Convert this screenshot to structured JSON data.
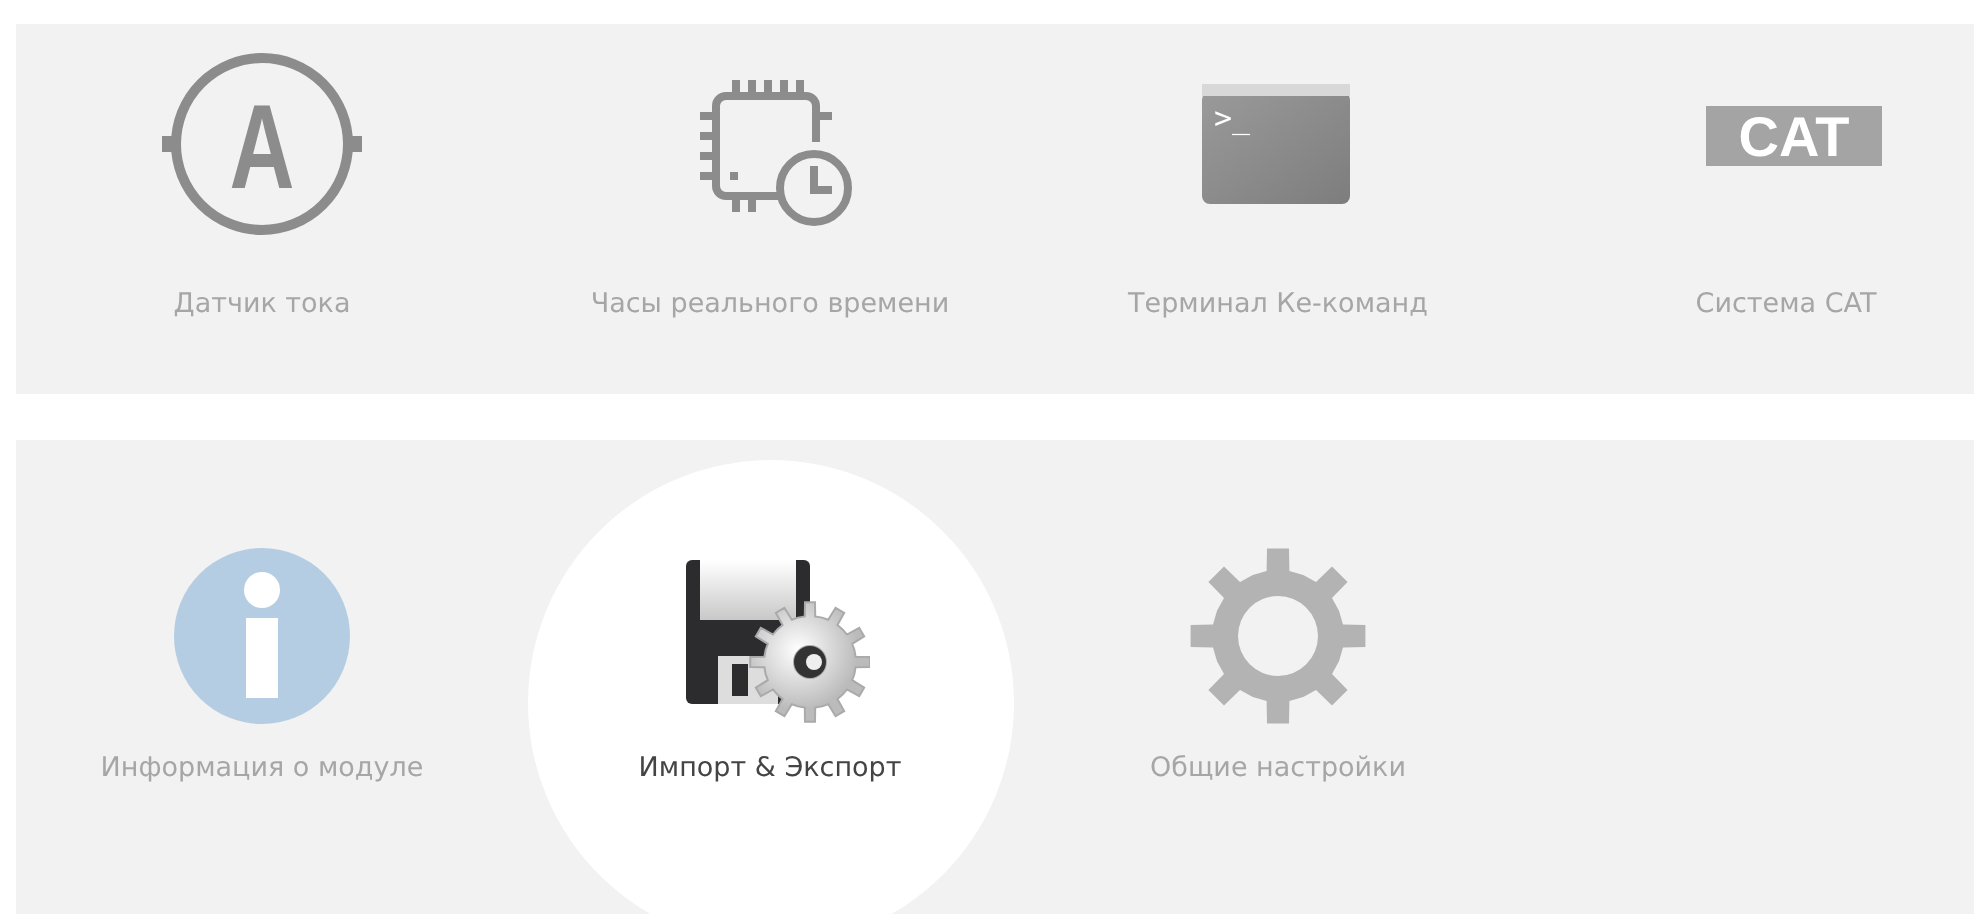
{
  "rows": [
    {
      "items": [
        {
          "kind": "ammeter",
          "icon_text": "A",
          "label": "Датчик тока",
          "selected": false
        },
        {
          "kind": "clock-chip",
          "label": "Часы реального времени",
          "selected": false
        },
        {
          "kind": "terminal",
          "icon_text": ">_",
          "label": "Терминал Ке-команд",
          "selected": false
        },
        {
          "kind": "cat",
          "icon_text": "CAT",
          "label": "Система CAT",
          "selected": false
        }
      ]
    },
    {
      "items": [
        {
          "kind": "info",
          "label": "Информация о модуле",
          "selected": false
        },
        {
          "kind": "floppy-gear",
          "label": "Импорт & Экспорт",
          "selected": true
        },
        {
          "kind": "gear",
          "label": "Общие настройки",
          "selected": false
        }
      ]
    }
  ]
}
